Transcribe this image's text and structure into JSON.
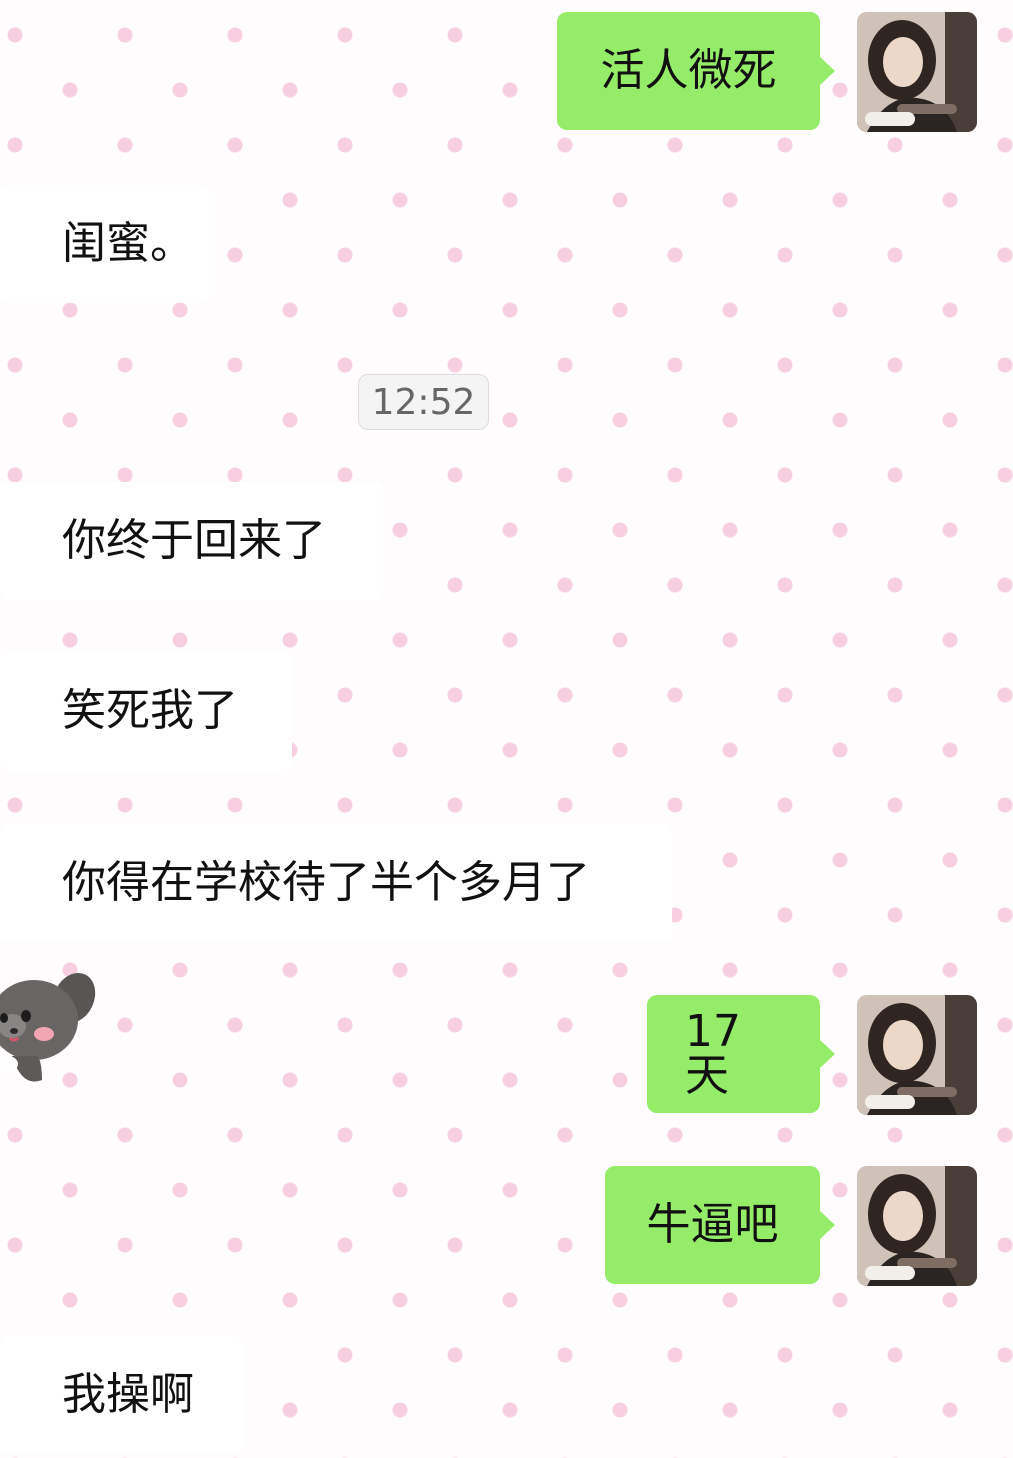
{
  "messages": [
    {
      "side": "out",
      "text": "活人微死"
    },
    {
      "side": "in",
      "text": "闺蜜。"
    },
    {
      "side": "time",
      "text": "12:52"
    },
    {
      "side": "in",
      "text": "你终于回来了"
    },
    {
      "side": "in",
      "text": "笑死我了"
    },
    {
      "side": "in",
      "text": "你得在学校待了半个多月了"
    },
    {
      "side": "out",
      "text": "17天"
    },
    {
      "side": "out",
      "text": "牛逼吧"
    },
    {
      "side": "in",
      "text": "我操啊"
    }
  ],
  "colors": {
    "outgoing_bubble": "#95ec69",
    "incoming_bubble": "#ffffff",
    "background": "#fffcfd",
    "polka_dot": "#f7cfe0",
    "timestamp_text": "#666666"
  },
  "icons": {
    "avatar": "user-avatar-photo",
    "sticker": "gray-puppy-sticker"
  }
}
